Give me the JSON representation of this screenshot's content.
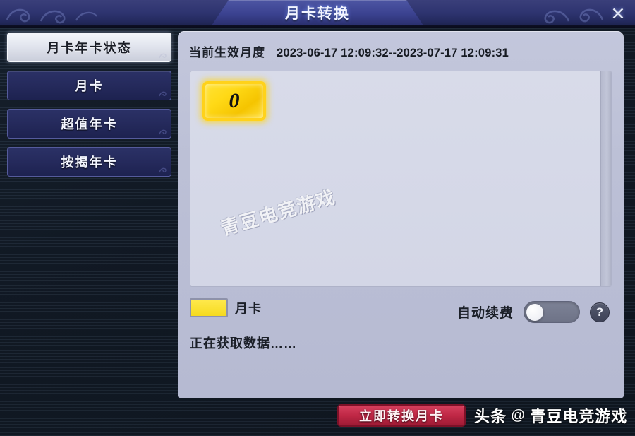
{
  "window": {
    "title": "月卡转换",
    "close_icon": "close-icon",
    "close_label": "✕"
  },
  "sidebar": {
    "items": [
      {
        "label": "月卡年卡状态",
        "active": true
      },
      {
        "label": "月卡",
        "active": false
      },
      {
        "label": "超值年卡",
        "active": false
      },
      {
        "label": "按揭年卡",
        "active": false
      }
    ]
  },
  "main": {
    "header": {
      "label": "当前生效月度",
      "value": "2023-06-17 12:09:32--2023-07-17 12:09:31"
    },
    "cards": [
      {
        "value": "0",
        "type": "month-card"
      }
    ],
    "watermark_inner": "青豆电竞游戏",
    "legend": {
      "swatch_color": "#f5da1e",
      "label": "月卡"
    },
    "auto_renew": {
      "label": "自动续费",
      "state": "off",
      "help_label": "?"
    },
    "status": "正在获取数据……"
  },
  "footer": {
    "convert_button": "立即转换月卡",
    "watermark_platform": "头条",
    "watermark_at": "@",
    "watermark_user": "青豆电竞游戏"
  },
  "colors": {
    "accent_red": "#bf2745",
    "card_yellow": "#ffd916",
    "title_blue": "#2e3470",
    "panel_bg": "#bcc0d6"
  }
}
